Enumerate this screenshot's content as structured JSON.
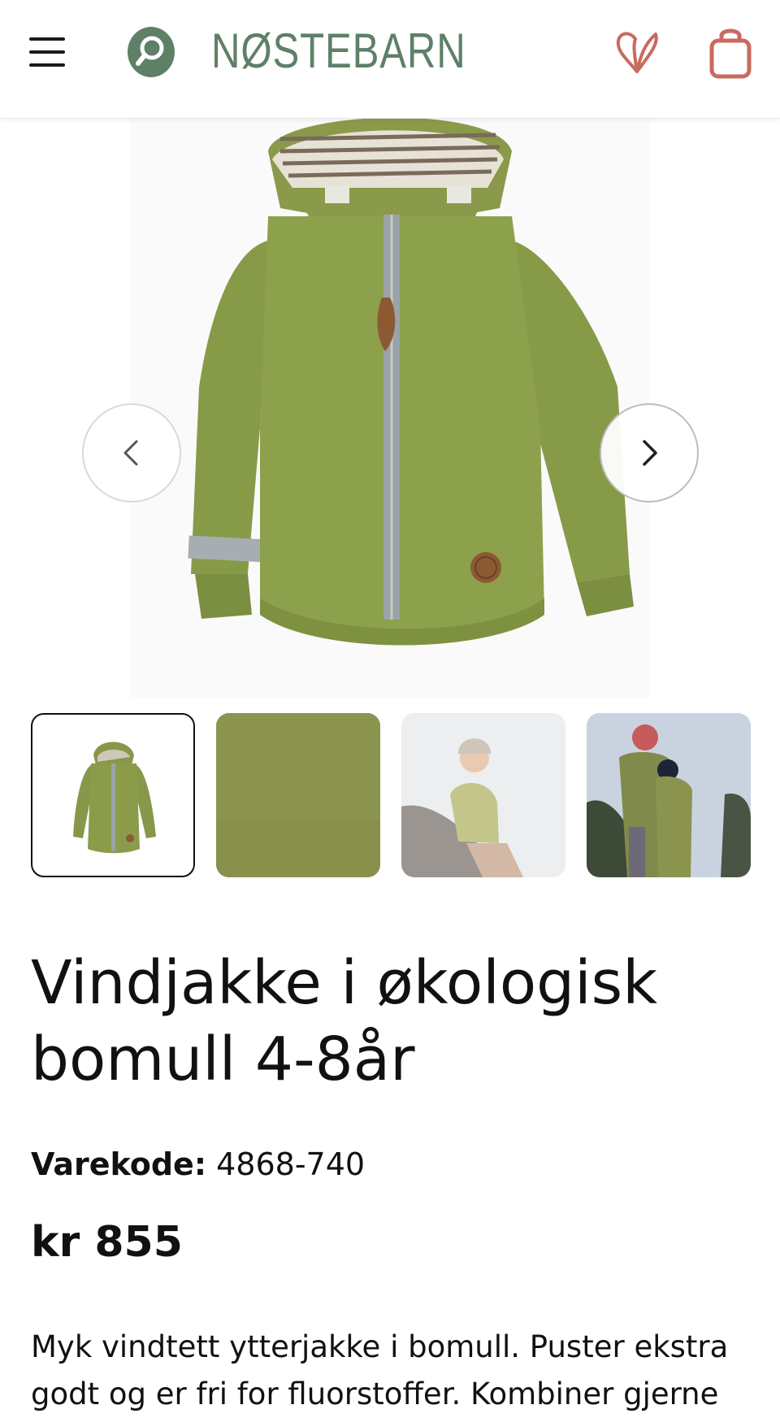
{
  "header": {
    "brand": "NØSTEBARN",
    "menu_icon": "hamburger-menu-icon",
    "search_icon": "search-icon",
    "wishlist_icon": "heart-icon",
    "cart_icon": "shopping-bag-icon",
    "brand_color": "#5e8067",
    "accent_color": "#c96a5e"
  },
  "gallery": {
    "prev_icon": "chevron-left-icon",
    "next_icon": "chevron-right-icon",
    "thumbnails": [
      {
        "name": "jacket-product-photo",
        "selected": true
      },
      {
        "name": "fabric-swatch",
        "selected": false
      },
      {
        "name": "child-wearing-jacket-on-rock",
        "selected": false
      },
      {
        "name": "children-outdoors-winter",
        "selected": false
      }
    ]
  },
  "product": {
    "title": "Vindjakke i økologisk bomull 4-8år",
    "sku_label": "Varekode:",
    "sku_value": "4868-740",
    "price": "kr 855",
    "description": "Myk vindtett ytterjakke i bomull. Puster ekstra godt og er fri for fluorstoffer. Kombiner gjerne"
  }
}
